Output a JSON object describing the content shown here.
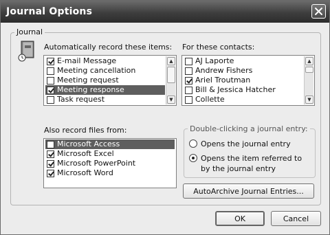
{
  "window": {
    "title": "Journal Options"
  },
  "journal_group": {
    "label": "Journal"
  },
  "auto_record": {
    "heading": "Automatically record these items:",
    "items": [
      {
        "label": "E-mail Message",
        "checked": true,
        "selected": false
      },
      {
        "label": "Meeting cancellation",
        "checked": false,
        "selected": false
      },
      {
        "label": "Meeting request",
        "checked": false,
        "selected": false
      },
      {
        "label": "Meeting response",
        "checked": true,
        "selected": true
      },
      {
        "label": "Task request",
        "checked": false,
        "selected": false
      }
    ]
  },
  "contacts": {
    "heading": "For these contacts:",
    "items": [
      {
        "label": "AJ Laporte",
        "checked": false,
        "selected": false
      },
      {
        "label": "Andrew Fishers",
        "checked": false,
        "selected": false
      },
      {
        "label": "Ariel Troutman",
        "checked": true,
        "selected": false
      },
      {
        "label": "Bill & Jessica Hatcher",
        "checked": false,
        "selected": false
      },
      {
        "label": "Collette",
        "checked": false,
        "selected": false
      }
    ]
  },
  "files": {
    "heading": "Also record files from:",
    "items": [
      {
        "label": "Microsoft Access",
        "checked": false,
        "selected": true
      },
      {
        "label": "Microsoft Excel",
        "checked": true,
        "selected": false
      },
      {
        "label": "Microsoft PowerPoint",
        "checked": true,
        "selected": false
      },
      {
        "label": "Microsoft Word",
        "checked": true,
        "selected": false
      }
    ]
  },
  "double_click": {
    "label": "Double-clicking a journal entry:",
    "options": [
      {
        "label": "Opens the journal entry",
        "selected": false
      },
      {
        "label": "Opens the item referred to by the journal entry",
        "selected": true
      }
    ]
  },
  "buttons": {
    "autoarchive": "AutoArchive Journal Entries...",
    "ok": "OK",
    "cancel": "Cancel"
  },
  "icons": {
    "close": "close-icon",
    "journal": "journal-book-icon",
    "scroll_up": "scroll-up-arrow-icon",
    "scroll_down": "scroll-down-arrow-icon"
  }
}
